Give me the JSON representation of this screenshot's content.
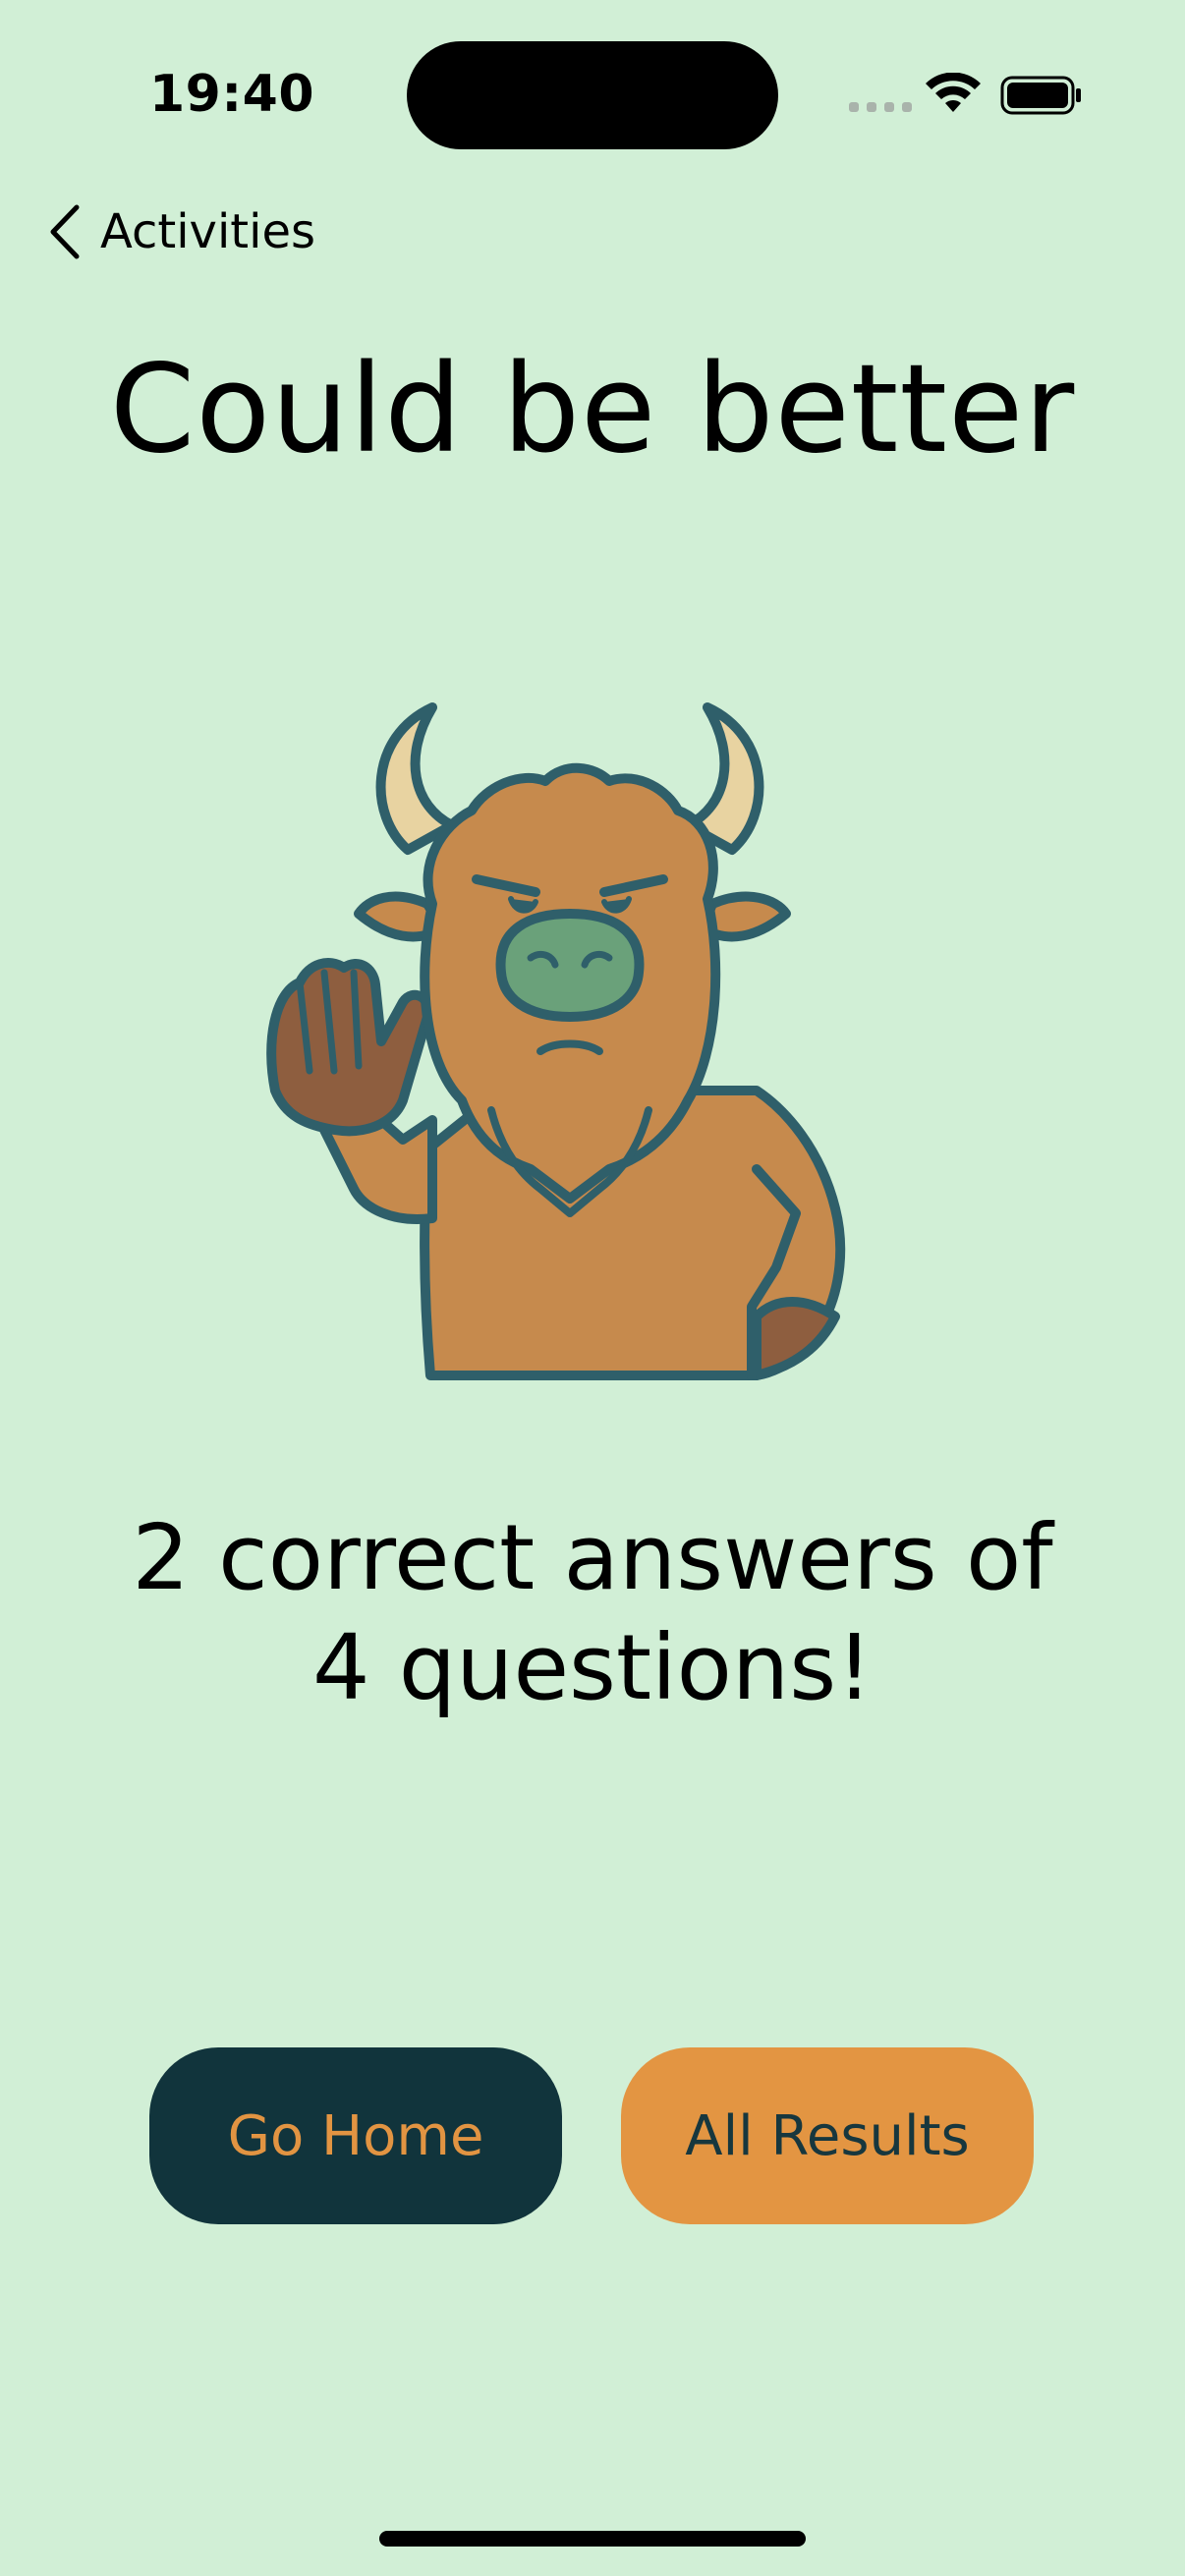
{
  "status_bar": {
    "time": "19:40",
    "icons": [
      "cellular-signal-icon",
      "wifi-icon",
      "battery-icon"
    ]
  },
  "nav": {
    "back_label": "Activities",
    "back_icon": "chevron-left-icon"
  },
  "title": "Could be better",
  "mascot": {
    "icon": "bison-mascot-stop-gesture",
    "colors": {
      "fur": "#c68a4d",
      "outline": "#2f5f6a",
      "horn": "#e8d3a1",
      "nose": "#6aa17a",
      "hand": "#8e5e3f"
    }
  },
  "result": {
    "line1": "2 correct answers of",
    "line2": "4 questions!"
  },
  "buttons": {
    "home_label": "Go Home",
    "results_label": "All Results"
  },
  "colors": {
    "background": "#d1efd6",
    "home_button_bg": "#11343c",
    "home_button_text": "#e29442",
    "results_button_bg": "#e39542",
    "results_button_text": "#17373e"
  }
}
